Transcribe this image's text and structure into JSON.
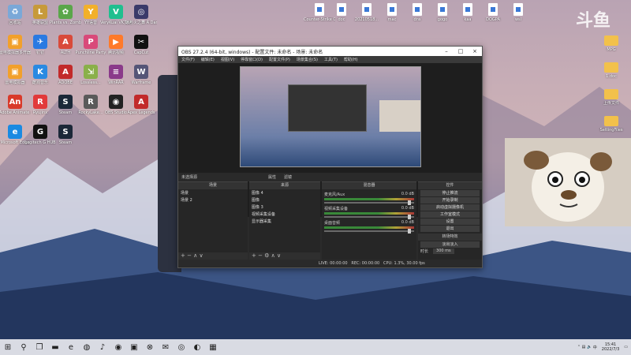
{
  "desktop_icons": [
    {
      "label": "回收站",
      "icon": "recycle-bin-icon",
      "color": "#7aa8d8",
      "glyph": "♻"
    },
    {
      "label": "英雄联盟",
      "icon": "lol-icon",
      "color": "#c79a3a",
      "glyph": "L"
    },
    {
      "label": "Plants vs. Zombies Re...",
      "icon": "pvz-icon",
      "color": "#5aa64a",
      "glyph": "✿"
    },
    {
      "label": "YY语音",
      "icon": "yy-icon",
      "color": "#f2b02b",
      "glyph": "Y"
    },
    {
      "label": "VeryKuai VK加速器",
      "icon": "verykuai-icon",
      "color": "#1fbf8f",
      "glyph": "V"
    },
    {
      "label": "冰与火之舞 A Dance of F...",
      "icon": "adofai-icon",
      "color": "#3a3a6a",
      "glyph": "◎"
    },
    {
      "label": "雷电模拟器多开器",
      "icon": "ldplayer-icon",
      "color": "#f2a02b",
      "glyph": "▣"
    },
    {
      "label": "钉钉",
      "icon": "dingtalk-icon",
      "color": "#2a7ae2",
      "glyph": "✈"
    },
    {
      "label": "ALTH",
      "icon": "alth-icon",
      "color": "#d94a3a",
      "glyph": "A"
    },
    {
      "label": "Punchline Party",
      "icon": "punchline-icon",
      "color": "#d94a7a",
      "glyph": "P"
    },
    {
      "label": "腾讯视频",
      "icon": "tencent-video-icon",
      "color": "#ff7a2a",
      "glyph": "▶"
    },
    {
      "label": "CapCut",
      "icon": "capcut-icon",
      "color": "#111111",
      "glyph": "✂"
    },
    {
      "label": "雷电模拟器",
      "icon": "ldplayer2-icon",
      "color": "#f2a02b",
      "glyph": "▣"
    },
    {
      "label": "酷狗音乐",
      "icon": "kugou-icon",
      "color": "#2a8ae2",
      "glyph": "K"
    },
    {
      "label": "ADOBE",
      "icon": "adobe-icon",
      "color": "#c22a2a",
      "glyph": "A"
    },
    {
      "label": "Lossless...",
      "icon": "lossless-icon",
      "color": "#8ab04a",
      "glyph": "⇲"
    },
    {
      "label": "WinRAR",
      "icon": "winrar-icon",
      "color": "#8a3a8a",
      "glyph": "≡"
    },
    {
      "label": "Warframe",
      "icon": "warframe-icon",
      "color": "#555577",
      "glyph": "W"
    },
    {
      "label": "Adobe Animate 2022",
      "icon": "animate-icon",
      "color": "#d93a2a",
      "glyph": "An"
    },
    {
      "label": "Ryujinx",
      "icon": "ryujinx-icon",
      "color": "#e23a3a",
      "glyph": "R"
    },
    {
      "label": "Steam",
      "icon": "steam-icon",
      "color": "#1b2838",
      "glyph": "S"
    },
    {
      "label": "RockyLake...",
      "icon": "rocky-icon",
      "color": "#5a5a5a",
      "glyph": "R"
    },
    {
      "label": "OBS Studio",
      "icon": "obs-icon",
      "color": "#222222",
      "glyph": "◉"
    },
    {
      "label": "Apex Legends",
      "icon": "apex-icon",
      "color": "#c22a2a",
      "glyph": "A"
    },
    {
      "label": "Microsoft Edge",
      "icon": "edge-icon",
      "color": "#1a8ae2",
      "glyph": "e"
    },
    {
      "label": "Logitech G HUB",
      "icon": "ghub-icon",
      "color": "#111111",
      "glyph": "G"
    },
    {
      "label": "Steam",
      "icon": "steam2-icon",
      "color": "#1b2838",
      "glyph": "S"
    }
  ],
  "right_files": [
    {
      "label": "Counter-Strike Global Of...",
      "icon": "cs-file-icon"
    },
    {
      "label": "doc",
      "icon": "doc-file-icon"
    },
    {
      "label": "20210518...",
      "icon": "date-file-icon"
    },
    {
      "label": "mac",
      "icon": "mac-file-icon"
    },
    {
      "label": "dns",
      "icon": "dns-file-icon"
    },
    {
      "label": "gogo",
      "icon": "gogo-file-icon"
    },
    {
      "label": "kaa",
      "icon": "kaa-file-icon"
    },
    {
      "label": "DOGPA",
      "icon": "dogpa-file-icon"
    },
    {
      "label": "wsl",
      "icon": "wsl-file-icon"
    }
  ],
  "right_folders": [
    {
      "label": "MPG"
    },
    {
      "label": "1.doc"
    },
    {
      "label": "上传文件"
    },
    {
      "label": "SettingFiles"
    }
  ],
  "watermark": "斗鱼",
  "obs": {
    "title": "OBS 27.2.4 (64-bit, windows) - 配置文件: 未命名 - 场景: 未命名",
    "menu": [
      "文件(F)",
      "编辑(E)",
      "视图(V)",
      "停靠窗口(D)",
      "配置文件(P)",
      "场景集合(S)",
      "工具(T)",
      "帮助(H)"
    ],
    "no_source": "未选择源",
    "prop_btn": "属性",
    "filter_btn": "滤镜",
    "scenes_title": "场景",
    "scenes": [
      "场景",
      "场景 2"
    ],
    "sources_title": "来源",
    "sources": [
      "图像 4",
      "图像",
      "图像 3",
      "视频采集设备",
      "显示器采集"
    ],
    "mixer_title": "混音器",
    "mixer": [
      {
        "name": "麦克风/Aux",
        "db": "0.0 dB"
      },
      {
        "name": "视频采集设备",
        "db": "0.0 dB"
      },
      {
        "name": "桌面音频",
        "db": "0.0 dB"
      }
    ],
    "controls_title": "控件",
    "controls": [
      "停止推流",
      "开始录制",
      "启动虚拟摄像机",
      "工作室模式",
      "设置",
      "退出"
    ],
    "transition_title": "转场特效",
    "transition": "淡出淡入",
    "duration_label": "时长",
    "duration": "300 ms",
    "status": {
      "live": "LIVE: 00:00:00",
      "rec": "REC: 00:00:00",
      "cpu": "CPU: 1.3%, 30.00 fps"
    }
  },
  "taskbar": {
    "clock_time": "15:41",
    "clock_date": "2022/7/3",
    "icons": [
      "windows-icon",
      "search-icon",
      "taskview-icon",
      "explorer-icon",
      "edge-icon",
      "steam-icon",
      "tiktok-icon",
      "netease-icon",
      "app-icon",
      "xbox-icon",
      "wechat-icon",
      "obs-icon",
      "chrome-icon",
      "files-icon"
    ]
  }
}
